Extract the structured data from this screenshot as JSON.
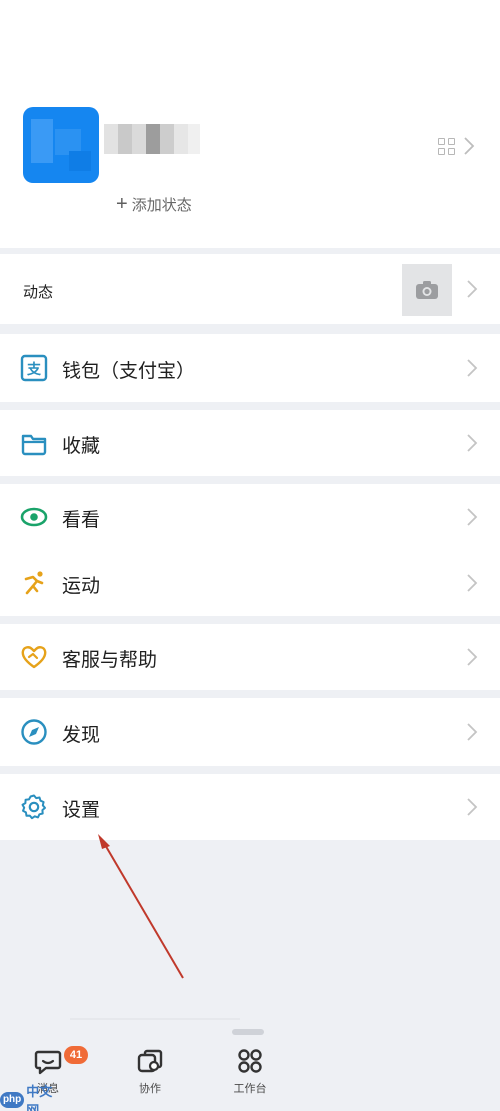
{
  "profile": {
    "add_status_label": "添加状态",
    "avatar_color": "#1586f0"
  },
  "moments": {
    "label": "动态"
  },
  "menu": {
    "wallet": "钱包（支付宝）",
    "favorites": "收藏",
    "watch": "看看",
    "sports": "运动",
    "support": "客服与帮助",
    "discover": "发现",
    "settings": "设置"
  },
  "tabbar": {
    "messages": {
      "label": "消息",
      "badge": "41"
    },
    "collab": {
      "label": "协作"
    },
    "workbench": {
      "label": "工作台"
    }
  },
  "watermark": {
    "logo": "php",
    "text": "中文网"
  },
  "colors": {
    "accent_blue": "#1586f0",
    "icon_teal": "#2a8fbf",
    "icon_green": "#1aa36a",
    "icon_gold": "#e6a21a",
    "badge_orange": "#f06b37",
    "arrow_red": "#c0392b"
  }
}
